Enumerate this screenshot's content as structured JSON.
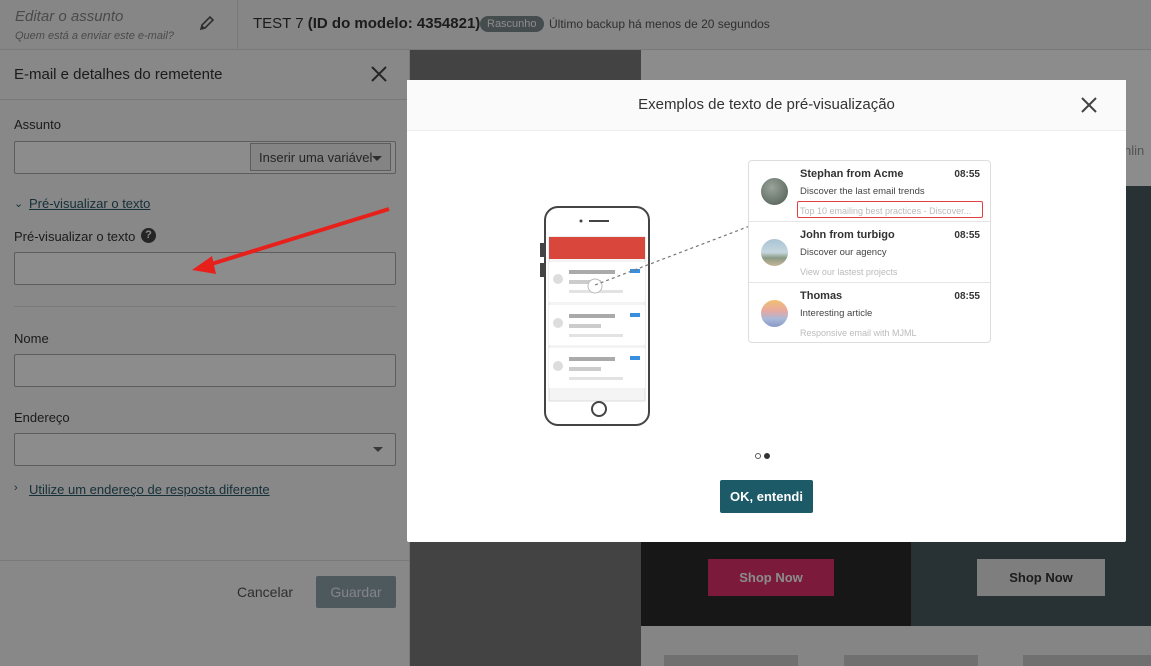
{
  "topbar": {
    "subject_placeholder": "Editar o assunto",
    "subject_sub": "Quem está a enviar este e-mail?",
    "doc_name": "TEST 7",
    "doc_model": "(ID do modelo: 4354821)",
    "status_badge": "Rascunho",
    "backup_text": "Último backup há menos de 20 segundos"
  },
  "panel": {
    "title": "E-mail e detalhes do remetente",
    "subject_label": "Assunto",
    "insert_variable": "Inserir uma variável",
    "preview_toggle": "Pré-visualizar o texto",
    "preview_label": "Pré-visualizar o texto",
    "help_glyph": "?",
    "name_label": "Nome",
    "address_label": "Endereço",
    "reply_link": "Utilize um endereço de resposta diferente",
    "cancel": "Cancelar",
    "save": "Guardar"
  },
  "background": {
    "shop_now_1": "Shop Now",
    "shop_now_2": "Shop Now",
    "online_fragment": "nlin"
  },
  "modal": {
    "title": "Exemplos de texto de pré-visualização",
    "ok_button": "OK, entendi",
    "inbox": [
      {
        "from": "Stephan from Acme",
        "time": "08:55",
        "subject": "Discover the last email trends",
        "preview": "Top 10 emailing best practices - Discover..."
      },
      {
        "from": "John from turbigo",
        "time": "08:55",
        "subject": "Discover our agency",
        "preview": "View our lastest projects"
      },
      {
        "from": "Thomas",
        "time": "08:55",
        "subject": "Interesting article",
        "preview": "Responsive email with MJML"
      }
    ]
  },
  "colors": {
    "accent": "#1d5a68",
    "arrow": "#e8201c",
    "shop_pink": "#e0306a",
    "phone_header": "#d9463c"
  }
}
